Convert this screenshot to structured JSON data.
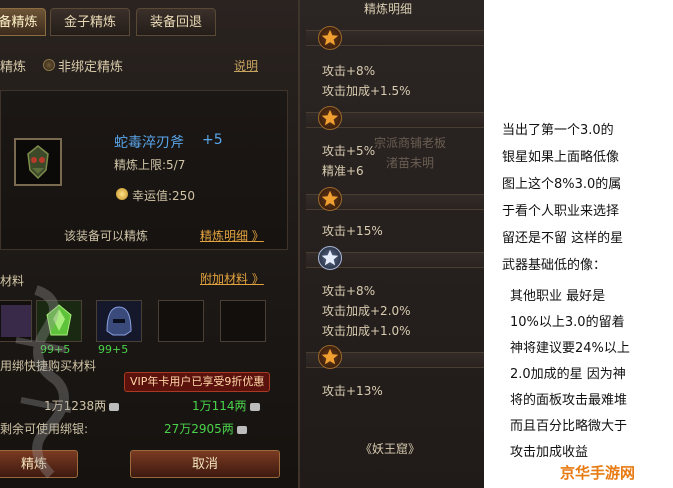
{
  "game": {
    "tabs": [
      "备精炼",
      "金子精炼",
      "装备回退"
    ],
    "option_refine": "精炼",
    "option_unbound": "非绑定精炼",
    "help": "说明",
    "item": {
      "name": "蛇毒淬刃斧",
      "plus": "+5",
      "limit": "精炼上限:5/7",
      "luck": "幸运值:250"
    },
    "can_refine": "该装备可以精炼",
    "refine_detail": "精炼明细 》",
    "materials_label": "材料",
    "add_materials": "附加材料 》",
    "material_counts": [
      "99+5",
      "99+5"
    ],
    "quick_buy": "用绑快捷购买材料",
    "vip_tip": "VIP年卡用户已享受9折优惠",
    "cost_left": "1万1238两",
    "cost_right": "1万114两",
    "remain_label": "剩余可使用绑银:",
    "remain_value": "27万2905两",
    "btn_ok": "精炼",
    "btn_cancel": "取消"
  },
  "detail": {
    "title": "精炼明细",
    "lines": [
      "攻击+8%",
      "攻击加成+1.5%",
      "攻击+5%",
      "精准+6",
      "攻击+15%",
      "攻击+8%",
      "攻击加成+2.0%",
      "攻击加成+1.0%",
      "攻击+13%"
    ],
    "ghost1": "宗派商铺老板",
    "ghost2": "渚苗未明",
    "footer": "《妖王窟》"
  },
  "commentary": {
    "p1": [
      "当出了第一个3.0的",
      "银星如果上面略低像",
      "图上这个8%3.0的属",
      "于看个人职业来选择",
      "留还是不留 这样的星",
      "武器基础低的像："
    ],
    "p2": [
      "其他职业 最好是",
      "10%以上3.0的留着",
      "神将建议要24%以上",
      "2.0加成的星 因为神",
      "将的面板攻击最难堆",
      "而且百分比略微大于",
      "攻击加成收益"
    ]
  },
  "logo": "京华手游网",
  "colors": {
    "accent_orange": "#e2a23e",
    "item_blue": "#59a6ea",
    "value_green": "#4ad24a",
    "vip_red": "#5b120c"
  }
}
